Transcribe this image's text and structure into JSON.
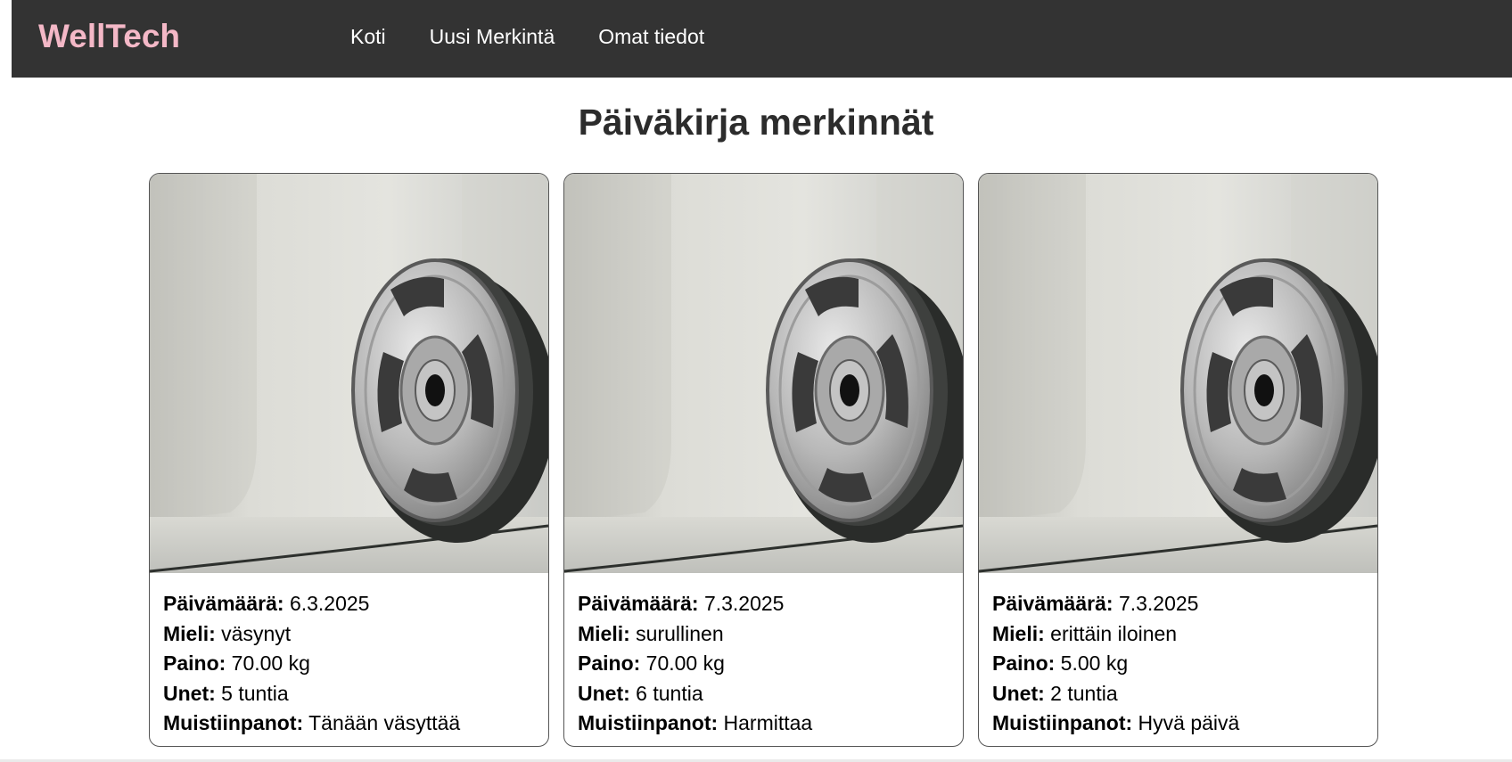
{
  "header": {
    "logo": "WellTech",
    "nav": [
      "Koti",
      "Uusi Merkintä",
      "Omat tiedot"
    ],
    "logo_color": "#f4b8c7",
    "bar_color": "#333333"
  },
  "page_title": "Päiväkirja merkinnät",
  "labels": {
    "date": "Päivämäärä:",
    "mood": "Mieli:",
    "weight": "Paino:",
    "sleep": "Unet:",
    "notes": "Muistiinpanot:"
  },
  "entries": [
    {
      "image": "weight-plate-image",
      "date": "6.3.2025",
      "mood": "väsynyt",
      "weight": "70.00 kg",
      "sleep": "5 tuntia",
      "notes": "Tänään väsyttää"
    },
    {
      "image": "weight-plate-image",
      "date": "7.3.2025",
      "mood": "surullinen",
      "weight": "70.00 kg",
      "sleep": "6 tuntia",
      "notes": "Harmittaa"
    },
    {
      "image": "weight-plate-image",
      "date": "7.3.2025",
      "mood": "erittäin iloinen",
      "weight": "5.00 kg",
      "sleep": "2 tuntia",
      "notes": "Hyvä päivä"
    }
  ]
}
